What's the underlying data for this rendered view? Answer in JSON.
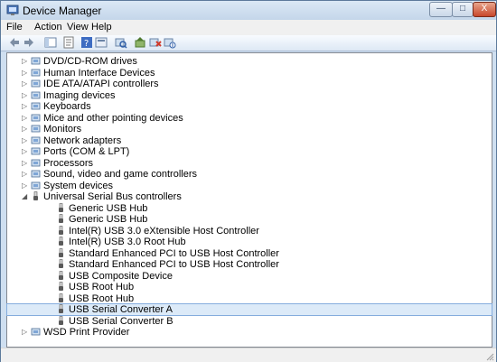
{
  "window": {
    "title": "Device Manager"
  },
  "caption": {
    "minimize": "—",
    "maximize": "□",
    "close": "X"
  },
  "menu": [
    "File",
    "Action",
    "View",
    "Help"
  ],
  "tree": [
    {
      "label": "DVD/CD-ROM drives",
      "icon": "disc-drive-icon",
      "level": 1,
      "expander": "collapsed"
    },
    {
      "label": "Human Interface Devices",
      "icon": "hid-icon",
      "level": 1,
      "expander": "collapsed"
    },
    {
      "label": "IDE ATA/ATAPI controllers",
      "icon": "ide-controller-icon",
      "level": 1,
      "expander": "collapsed"
    },
    {
      "label": "Imaging devices",
      "icon": "camera-icon",
      "level": 1,
      "expander": "collapsed"
    },
    {
      "label": "Keyboards",
      "icon": "keyboard-icon",
      "level": 1,
      "expander": "collapsed"
    },
    {
      "label": "Mice and other pointing devices",
      "icon": "mouse-icon",
      "level": 1,
      "expander": "collapsed"
    },
    {
      "label": "Monitors",
      "icon": "monitor-icon",
      "level": 1,
      "expander": "collapsed"
    },
    {
      "label": "Network adapters",
      "icon": "network-adapter-icon",
      "level": 1,
      "expander": "collapsed"
    },
    {
      "label": "Ports (COM & LPT)",
      "icon": "port-icon",
      "level": 1,
      "expander": "collapsed"
    },
    {
      "label": "Processors",
      "icon": "processor-icon",
      "level": 1,
      "expander": "collapsed"
    },
    {
      "label": "Sound, video and game controllers",
      "icon": "speaker-icon",
      "level": 1,
      "expander": "collapsed"
    },
    {
      "label": "System devices",
      "icon": "system-device-icon",
      "level": 1,
      "expander": "collapsed"
    },
    {
      "label": "Universal Serial Bus controllers",
      "icon": "usb-icon",
      "level": 1,
      "expander": "expanded"
    },
    {
      "label": "Generic USB Hub",
      "icon": "usb-icon",
      "level": 2
    },
    {
      "label": "Generic USB Hub",
      "icon": "usb-icon",
      "level": 2
    },
    {
      "label": "Intel(R) USB 3.0 eXtensible Host Controller",
      "icon": "usb-icon",
      "level": 2
    },
    {
      "label": "Intel(R) USB 3.0 Root Hub",
      "icon": "usb-icon",
      "level": 2
    },
    {
      "label": "Standard Enhanced PCI to USB Host Controller",
      "icon": "usb-icon",
      "level": 2
    },
    {
      "label": "Standard Enhanced PCI to USB Host Controller",
      "icon": "usb-icon",
      "level": 2
    },
    {
      "label": "USB Composite Device",
      "icon": "usb-icon",
      "level": 2
    },
    {
      "label": "USB Root Hub",
      "icon": "usb-icon",
      "level": 2
    },
    {
      "label": "USB Root Hub",
      "icon": "usb-icon",
      "level": 2
    },
    {
      "label": "USB Serial Converter A",
      "icon": "usb-icon",
      "level": 2,
      "selected": true
    },
    {
      "label": "USB Serial Converter B",
      "icon": "usb-icon",
      "level": 2
    },
    {
      "label": "WSD Print Provider",
      "icon": "printer-icon",
      "level": 1,
      "expander": "collapsed"
    }
  ],
  "toolbar": [
    "back-arrow-icon",
    "forward-arrow-icon",
    "show-hide-console-tree-icon",
    "properties-icon",
    "help-icon",
    "console-icon",
    "scan-hardware-changes-icon",
    "update-driver-icon",
    "uninstall-icon",
    "disable-icon"
  ],
  "colors": {
    "selection": "#dceaf8",
    "selection_border": "#84acdd",
    "frame": "#cfdff0"
  }
}
